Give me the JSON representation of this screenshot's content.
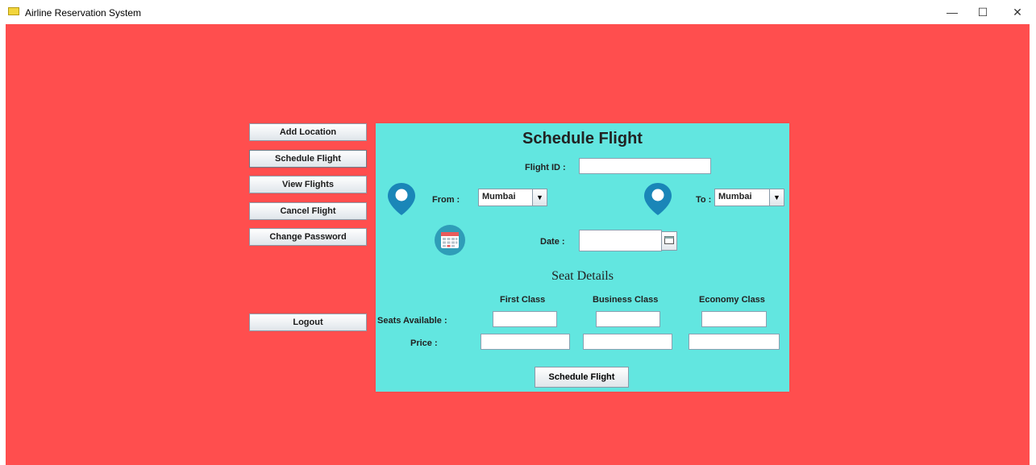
{
  "window": {
    "title": "Airline Reservation System",
    "minimize": "—",
    "maximize": "☐",
    "close": "✕"
  },
  "nav": {
    "add_location": "Add Location",
    "schedule_flight": "Schedule Flight",
    "view_flights": "View Flights",
    "cancel_flight": "Cancel Flight",
    "change_password": "Change Password",
    "logout": "Logout"
  },
  "form": {
    "title": "Schedule Flight",
    "flight_id_label": "Flight ID :",
    "flight_id_value": "",
    "from_label": "From :",
    "from_value": "Mumbai",
    "to_label": "To :",
    "to_value": "Mumbai",
    "date_label": "Date :",
    "date_value": "",
    "seat_details_title": "Seat Details",
    "columns": [
      "First Class",
      "Business Class",
      "Economy Class"
    ],
    "seats_available_label": "Seats Available :",
    "price_label": "Price :",
    "submit_label": "Schedule Flight"
  },
  "colors": {
    "background": "#ff4e4e",
    "panel": "#62e6e0",
    "pin": "#1a86b8"
  },
  "icons": {
    "from": "location-pin-icon",
    "to": "location-pin-icon",
    "date": "calendar-icon",
    "date_picker": "calendar-small-icon"
  }
}
